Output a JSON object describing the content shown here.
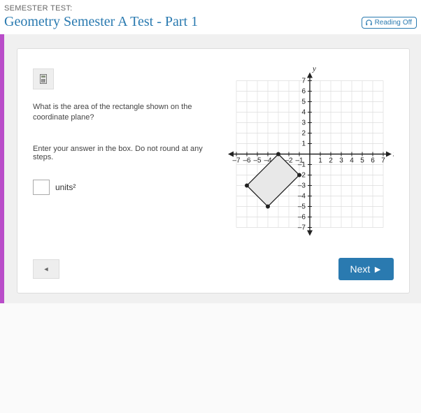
{
  "header": {
    "subtitle": "SEMESTER TEST:",
    "title": "Geometry Semester A Test - Part 1",
    "reading_label": "Reading",
    "reading_state": "Off"
  },
  "question": {
    "prompt": "What is the area of the rectangle shown on the coordinate plane?",
    "instruction": "Enter your answer in the box. Do not round at any steps.",
    "unit_suffix": "units²"
  },
  "nav": {
    "prev_glyph": "◄",
    "next_label": "Next ►"
  },
  "chart_data": {
    "type": "scatter",
    "title": "",
    "xlabel": "x",
    "ylabel": "y",
    "xlim": [
      -7,
      7
    ],
    "ylim": [
      -7,
      7
    ],
    "xticks": [
      -7,
      -6,
      -5,
      -4,
      -3,
      -2,
      -1,
      1,
      2,
      3,
      4,
      5,
      6,
      7
    ],
    "yticks": [
      -7,
      -6,
      -5,
      -4,
      -3,
      -2,
      -1,
      1,
      2,
      3,
      4,
      5,
      6,
      7
    ],
    "grid": true,
    "shape": "rectangle",
    "vertices": [
      {
        "x": -3,
        "y": 0
      },
      {
        "x": -1,
        "y": -2
      },
      {
        "x": -4,
        "y": -5
      },
      {
        "x": -6,
        "y": -3
      }
    ]
  }
}
